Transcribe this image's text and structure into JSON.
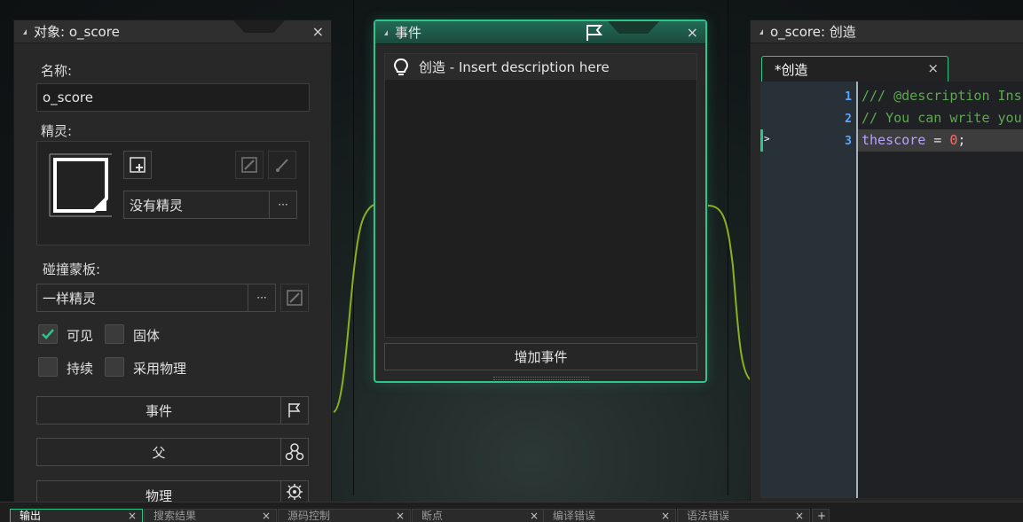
{
  "object_window": {
    "title": "对象: o_score",
    "name_label": "名称:",
    "name_value": "o_score",
    "sprite_label": "精灵:",
    "sprite_value": "没有精灵",
    "ellipsis": "···",
    "collision_mask_label": "碰撞蒙板:",
    "collision_mask_value": "一样精灵",
    "visible_label": "可见",
    "visible_checked": true,
    "solid_label": "固体",
    "solid_checked": false,
    "persistent_label": "持续",
    "persistent_checked": false,
    "physics_label": "采用物理",
    "physics_checked": false,
    "events_button": "事件",
    "parent_button": "父",
    "physics_button": "物理"
  },
  "events_window": {
    "title": "事件",
    "event_item": "创造 - Insert description here",
    "add_event_button": "增加事件"
  },
  "code_window": {
    "title": "o_score: 创造",
    "tab_label": "*创造",
    "lines": [
      {
        "num": "1",
        "text": "/// @description Ins"
      },
      {
        "num": "2",
        "text": "// You can write you"
      },
      {
        "num": "3",
        "var": "thescore",
        "op": " = ",
        "val": "0",
        "end": ";"
      }
    ],
    "caret_marker": ">"
  },
  "bottom_tabs": [
    "输出",
    "搜索结果",
    "源码控制",
    "断点",
    "编译错误",
    "语法错误"
  ],
  "add_tab": "+",
  "close_glyph": "×",
  "colors": {
    "accent_green": "#2ec48a",
    "connector": "#8ab020",
    "comment": "#5ea84f",
    "variable": "#b7a3ff",
    "number": "#ff6b6b",
    "line_number": "#58a6ff"
  }
}
